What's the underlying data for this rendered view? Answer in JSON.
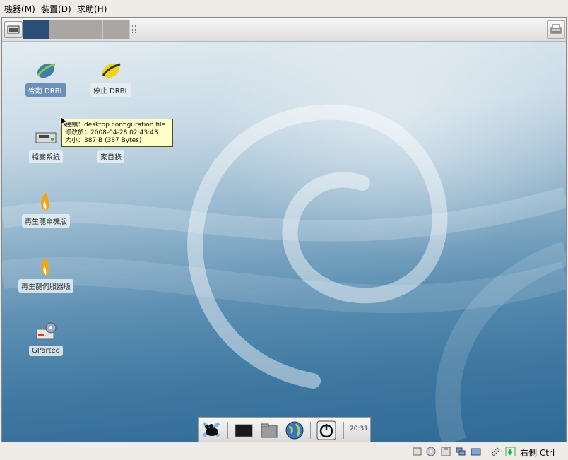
{
  "menubar": {
    "items": [
      {
        "label": "機器",
        "mnemonic": "M"
      },
      {
        "label": "裝置",
        "mnemonic": "D"
      },
      {
        "label": "求助",
        "mnemonic": "H"
      }
    ]
  },
  "desktop": {
    "icons": [
      {
        "label": "啓動 DRBL",
        "icon": "drbl-start-leaf-icon",
        "selected": true
      },
      {
        "label": "停止 DRBL",
        "icon": "drbl-stop-leaf-icon",
        "selected": false
      },
      {
        "label": "檔案系統",
        "icon": "drive-icon",
        "selected": false
      },
      {
        "label": "家目錄",
        "icon": "home-folder-icon",
        "selected": false
      },
      {
        "label": "再生龍單機版",
        "icon": "clonezilla-flame-icon",
        "selected": false
      },
      {
        "label": "再生龍伺服器版",
        "icon": "clonezilla-flame-icon",
        "selected": false
      },
      {
        "label": "GParted",
        "icon": "gparted-icon",
        "selected": false
      }
    ],
    "tooltip": {
      "line1": "種類：desktop configuration file",
      "line2": "修改於：2008-04-28 02:43:43",
      "line3": "大小：387 B (387 Bytes)"
    }
  },
  "dock": {
    "items": [
      "xfce-mouse-icon",
      "terminal-icon",
      "file-manager-icon",
      "web-browser-globe-icon",
      "power-icon"
    ],
    "clock": "20:31"
  },
  "statusbar": {
    "icons": [
      "hard-disk-icon",
      "cd-icon",
      "floppy-icon",
      "network-icon",
      "shared-folder-icon",
      "usb-icon",
      "mouse-integration-icon"
    ],
    "host_key": "右側 Ctrl"
  },
  "colors": {
    "desktop_top": "#e3ecf2",
    "desktop_bottom": "#2f6a95",
    "selected_label": "#6a8fb9",
    "tooltip_bg": "#ffffc8"
  }
}
